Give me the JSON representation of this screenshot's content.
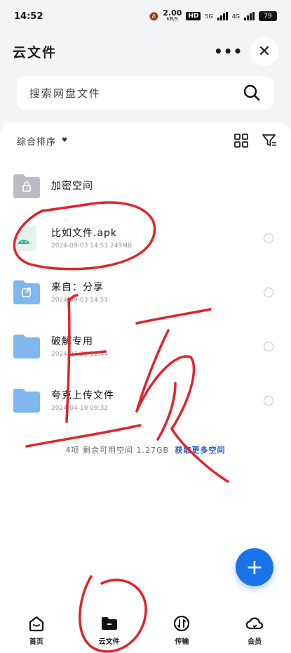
{
  "status_bar": {
    "time": "14:52",
    "speed": "2.00",
    "speed_unit": "KB/S",
    "hd_label": "HD",
    "net5g": "5G",
    "net4g": "4G",
    "battery": "79"
  },
  "header": {
    "title": "云文件",
    "more_glyph": "•••",
    "close_glyph": "✕"
  },
  "search": {
    "placeholder": "搜索网盘文件",
    "icon": "search-icon"
  },
  "sortbar": {
    "label": "综合排序",
    "caret": "♥"
  },
  "files": [
    {
      "name": "加密空间",
      "meta": "",
      "icon": "lock-folder-icon"
    },
    {
      "name": "比如文件.apk",
      "meta": "2024-09-03 14:51  249MB",
      "icon": "android-apk-icon"
    },
    {
      "name": "来自：分享",
      "meta": "2024-09-03 14:51",
      "icon": "share-folder-icon"
    },
    {
      "name": "破解专用",
      "meta": "2024-07-21 12:44",
      "icon": "folder-icon"
    },
    {
      "name": "夸克上传文件",
      "meta": "2024-04-19 09:32",
      "icon": "folder-icon"
    }
  ],
  "summary": {
    "text": "4项 剩余可用空间 1.27GB",
    "link": "获取更多空间"
  },
  "fab": {
    "glyph": "+"
  },
  "tabs": [
    {
      "label": "首页",
      "icon": "home-icon"
    },
    {
      "label": "云文件",
      "icon": "folder-icon"
    },
    {
      "label": "传输",
      "icon": "transfer-icon"
    },
    {
      "label": "会员",
      "icon": "cloud-member-icon"
    }
  ],
  "colors": {
    "accent": "#1a73e8",
    "link": "#1a56db",
    "folder": "#7fb6ee",
    "scribble": "#e0242a"
  }
}
